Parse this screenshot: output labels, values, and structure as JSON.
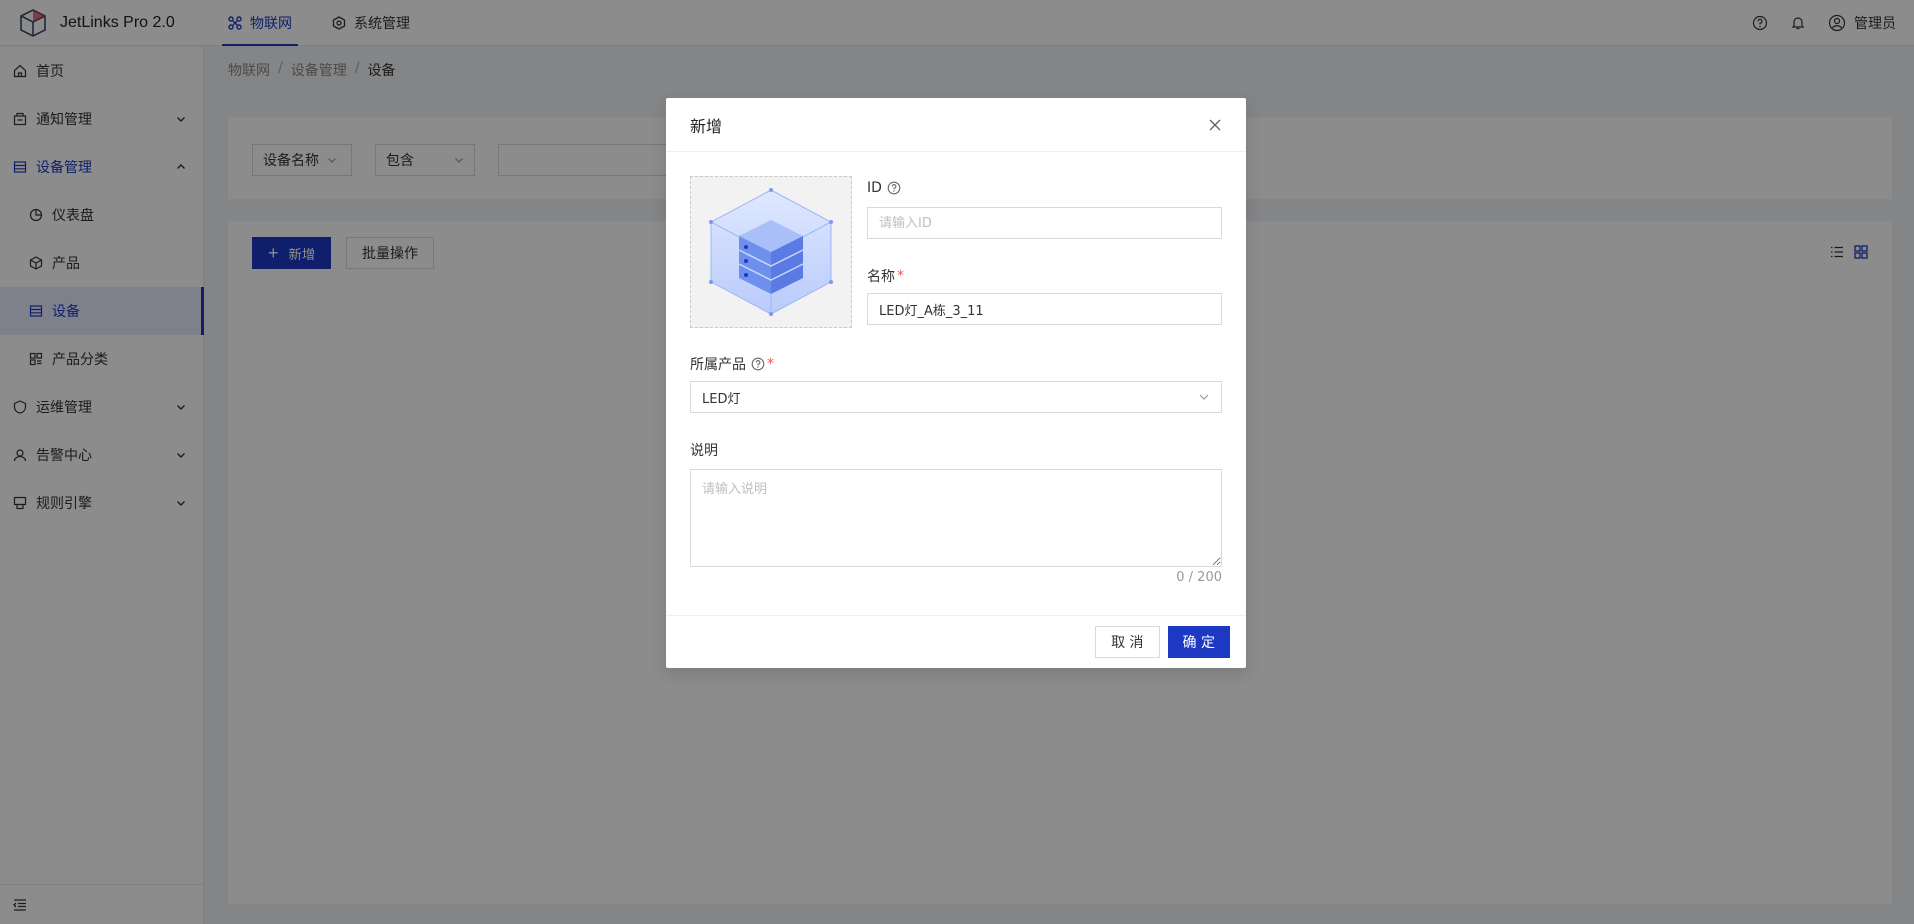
{
  "app": {
    "title": "JetLinks Pro 2.0"
  },
  "top_nav": [
    {
      "label": "物联网",
      "icon": "iot-icon",
      "active": true
    },
    {
      "label": "系统管理",
      "icon": "system-icon",
      "active": false
    }
  ],
  "header": {
    "user_name": "管理员"
  },
  "sidebar": {
    "items": [
      {
        "label": "首页",
        "icon": "home-icon"
      },
      {
        "label": "通知管理",
        "icon": "notify-icon"
      },
      {
        "label": "设备管理",
        "icon": "device-mgmt-icon"
      },
      {
        "label": "仪表盘",
        "icon": "dashboard-icon"
      },
      {
        "label": "产品",
        "icon": "product-icon"
      },
      {
        "label": "设备",
        "icon": "device-icon"
      },
      {
        "label": "产品分类",
        "icon": "category-icon"
      },
      {
        "label": "运维管理",
        "icon": "ops-icon"
      },
      {
        "label": "告警中心",
        "icon": "alarm-icon"
      },
      {
        "label": "规则引擎",
        "icon": "rule-icon"
      }
    ]
  },
  "breadcrumb": {
    "items": [
      "物联网",
      "设备管理",
      "设备"
    ],
    "separator": "/"
  },
  "search": {
    "field": "设备名称",
    "operator": "包含"
  },
  "toolbar": {
    "add_label": "新增",
    "batch_label": "批量操作"
  },
  "modal": {
    "title": "新增",
    "id_label": "ID",
    "id_placeholder": "请输入ID",
    "name_label": "名称",
    "name_value": "LED灯_A栋_3_11",
    "product_label": "所属产品",
    "product_value": "LED灯",
    "desc_label": "说明",
    "desc_placeholder": "请输入说明",
    "counter": "0 / 200",
    "cancel_label": "取 消",
    "ok_label": "确 定"
  },
  "colors": {
    "primary": "#1d39c4",
    "required": "#ff4d4f"
  }
}
